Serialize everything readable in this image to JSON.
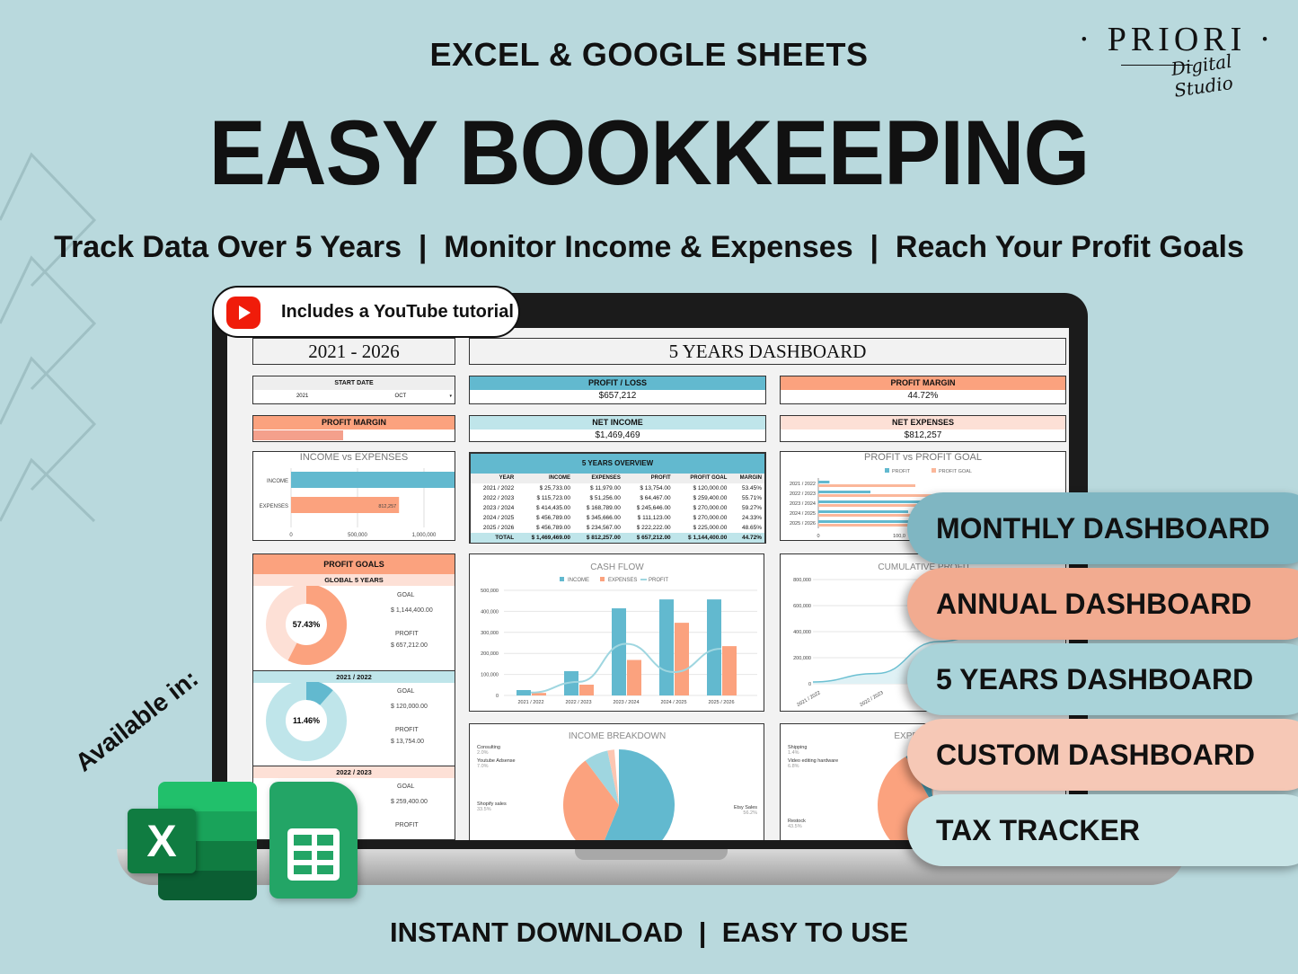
{
  "header": {
    "platforms": "EXCEL & GOOGLE SHEETS",
    "title": "EASY BOOKKEEPING",
    "tagline": "Track Data Over 5 Years  |  Monitor Income & Expenses  |  Reach Your Profit Goals"
  },
  "logo": {
    "name": "· PRIORI ·",
    "script": "Digital Studio"
  },
  "badge": {
    "text": "Includes a YouTube tutorial",
    "icon": "youtube-play-icon"
  },
  "dashboard": {
    "period": "2021 - 2026",
    "title": "5 YEARS DASHBOARD",
    "start_date": {
      "label": "START DATE",
      "year": "2021",
      "month": "OCT"
    },
    "profit_loss": {
      "label": "PROFIT / LOSS",
      "value": "$657,212"
    },
    "profit_margin_top": {
      "label": "PROFIT MARGIN",
      "value": "44.72%"
    },
    "profit_margin_bar": {
      "label": "PROFIT MARGIN",
      "fill": 0.4472
    },
    "net_income": {
      "label": "NET INCOME",
      "value": "$1,469,469"
    },
    "net_expenses": {
      "label": "NET EXPENSES",
      "value": "$812,257"
    },
    "income_vs_expenses": {
      "title": "INCOME vs EXPENSES",
      "categories": [
        "INCOME",
        "EXPENSES"
      ],
      "values": [
        1469469,
        812257
      ],
      "labels": [
        "1,469,469",
        "812,257"
      ],
      "ticks": [
        "0",
        "500,000",
        "1,000,000"
      ]
    },
    "overview": {
      "title": "5 YEARS OVERVIEW",
      "columns": [
        "YEAR",
        "INCOME",
        "EXPENSES",
        "PROFIT",
        "PROFIT GOAL",
        "MARGIN"
      ],
      "rows": [
        [
          "2021 / 2022",
          "$ 25,733.00",
          "$ 11,979.00",
          "$ 13,754.00",
          "$ 120,000.00",
          "53.45%"
        ],
        [
          "2022 / 2023",
          "$ 115,723.00",
          "$ 51,256.00",
          "$ 64,467.00",
          "$ 259,400.00",
          "55.71%"
        ],
        [
          "2023 / 2024",
          "$ 414,435.00",
          "$ 168,789.00",
          "$ 245,646.00",
          "$ 270,000.00",
          "59.27%"
        ],
        [
          "2024 / 2025",
          "$ 456,789.00",
          "$ 345,666.00",
          "$ 111,123.00",
          "$ 270,000.00",
          "24.33%"
        ],
        [
          "2025 / 2026",
          "$ 456,789.00",
          "$ 234,567.00",
          "$ 222,222.00",
          "$ 225,000.00",
          "48.65%"
        ]
      ],
      "total": [
        "TOTAL",
        "$ 1,469,469.00",
        "$ 812,257.00",
        "$ 657,212.00",
        "$ 1,144,400.00",
        "44.72%"
      ]
    },
    "profit_goals": {
      "title": "PROFIT GOALS",
      "sections": [
        {
          "label": "GLOBAL 5 YEARS",
          "percent": "57.43%",
          "fraction": 0.5743,
          "goal_label": "GOAL",
          "goal": "$ 1,144,400.00",
          "profit_label": "PROFIT",
          "profit": "$ 657,212.00"
        },
        {
          "label": "2021 / 2022",
          "percent": "11.46%",
          "fraction": 0.1146,
          "goal_label": "GOAL",
          "goal": "$ 120,000.00",
          "profit_label": "PROFIT",
          "profit": "$ 13,754.00"
        },
        {
          "label": "2022 / 2023",
          "goal_label": "GOAL",
          "goal": "$ 259,400.00",
          "profit_label": "PROFIT"
        }
      ]
    }
  },
  "chart_data": [
    {
      "type": "bar",
      "title": "PROFIT vs PROFIT GOAL",
      "orientation": "horizontal",
      "categories": [
        "2021 / 2022",
        "2022 / 2023",
        "2023 / 2024",
        "2024 / 2025",
        "2025 / 2026"
      ],
      "series": [
        {
          "name": "PROFIT",
          "values": [
            13754,
            64467,
            245646,
            111123,
            222222
          ],
          "color": "#62b9cf"
        },
        {
          "name": "PROFIT GOAL",
          "values": [
            120000,
            259400,
            270000,
            270000,
            225000
          ],
          "color": "#fbb79a"
        }
      ],
      "ticks": [
        "0",
        "100,0"
      ]
    },
    {
      "type": "bar",
      "title": "CASH FLOW",
      "categories": [
        "2021 / 2022",
        "2022 / 2023",
        "2023 / 2024",
        "2024 / 2025",
        "2025 / 2026"
      ],
      "series": [
        {
          "name": "INCOME",
          "values": [
            25733,
            115723,
            414435,
            456789,
            456789
          ],
          "color": "#62b9cf"
        },
        {
          "name": "EXPENSES",
          "values": [
            11979,
            51256,
            168789,
            345666,
            234567
          ],
          "color": "#fba27e"
        },
        {
          "name": "PROFIT",
          "type": "line",
          "values": [
            13754,
            64467,
            245646,
            111123,
            222222
          ],
          "color": "#9fd6e0"
        }
      ],
      "ylim": [
        0,
        500000
      ],
      "yticks": [
        "0",
        "100,000",
        "200,000",
        "300,000",
        "400,000",
        "500,000"
      ],
      "legend": "top"
    },
    {
      "type": "area",
      "title": "CUMULATIVE PROFIT",
      "categories": [
        "2021 / 2022",
        "2022 / 2023",
        "2023 / 2024",
        "2024 / 2025",
        "2025 / 2026"
      ],
      "values": [
        13754,
        78221,
        323867,
        434990,
        657212
      ],
      "ylim": [
        0,
        800000
      ],
      "yticks": [
        "0",
        "200,000",
        "400,000",
        "600,000",
        "800,000"
      ]
    },
    {
      "type": "pie",
      "title": "INCOME BREAKDOWN",
      "slices": [
        {
          "label": "Etsy Sales",
          "pct": "56.2%",
          "value": 56.2,
          "color": "#62b9cf"
        },
        {
          "label": "Shopify sales",
          "pct": "33.5%",
          "value": 33.5,
          "color": "#fba27e"
        },
        {
          "label": "Youtube Adsense",
          "pct": "7.0%",
          "value": 7.0,
          "color": "#9fd6e0"
        },
        {
          "label": "Consulting",
          "pct": "2.0%",
          "value": 2.0,
          "color": "#fcc6b2"
        }
      ]
    },
    {
      "type": "pie",
      "title": "EXPENSE",
      "slices": [
        {
          "label": "Restock",
          "pct": "43.5%",
          "value": 43.5,
          "color": "#fba27e"
        },
        {
          "label": "Video editing hardware",
          "pct": "6.8%",
          "value": 6.8,
          "color": "#4a9fb5"
        },
        {
          "label": "Shipping",
          "pct": "1.4%",
          "value": 1.4,
          "color": "#fcc6b2"
        }
      ]
    }
  ],
  "menu": [
    {
      "label": "MONTHLY DASHBOARD",
      "color": "#7fb6c2"
    },
    {
      "label": "ANNUAL DASHBOARD",
      "color": "#f2ab90"
    },
    {
      "label": "5 YEARS DASHBOARD",
      "color": "#a9d3d9"
    },
    {
      "label": "CUSTOM DASHBOARD",
      "color": "#f6c8b6"
    },
    {
      "label": "TAX TRACKER",
      "color": "#c9e5e7"
    }
  ],
  "availability": {
    "label": "Available in:",
    "apps": [
      "excel-icon",
      "google-sheets-icon"
    ]
  },
  "footer": "INSTANT DOWNLOAD  |  EASY TO USE"
}
